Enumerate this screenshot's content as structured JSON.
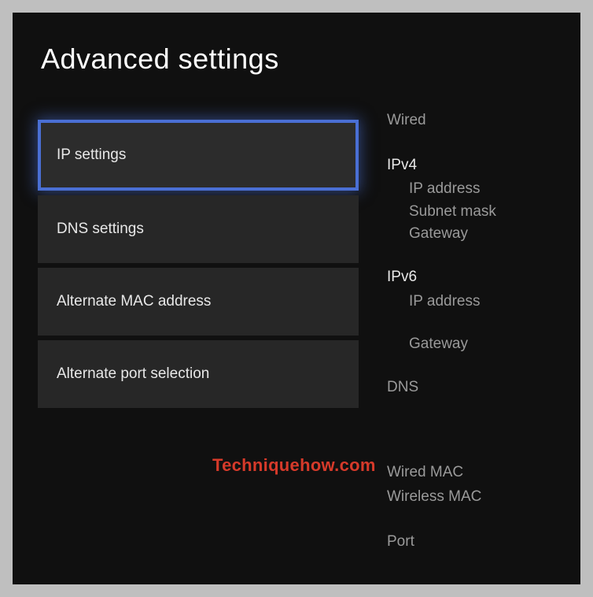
{
  "title": "Advanced settings",
  "menu": {
    "items": [
      {
        "label": "IP settings",
        "selected": true
      },
      {
        "label": "DNS settings",
        "selected": false
      },
      {
        "label": "Alternate MAC address",
        "selected": false
      },
      {
        "label": "Alternate port selection",
        "selected": false
      }
    ]
  },
  "details": {
    "connection_type": "Wired",
    "ipv4": {
      "heading": "IPv4",
      "ip_address_label": "IP address",
      "subnet_mask_label": "Subnet mask",
      "gateway_label": "Gateway"
    },
    "ipv6": {
      "heading": "IPv6",
      "ip_address_label": "IP address",
      "gateway_label": "Gateway"
    },
    "dns_label": "DNS",
    "wired_mac_label": "Wired MAC",
    "wireless_mac_label": "Wireless MAC",
    "port_label": "Port"
  },
  "watermark": "Techniquehow.com"
}
